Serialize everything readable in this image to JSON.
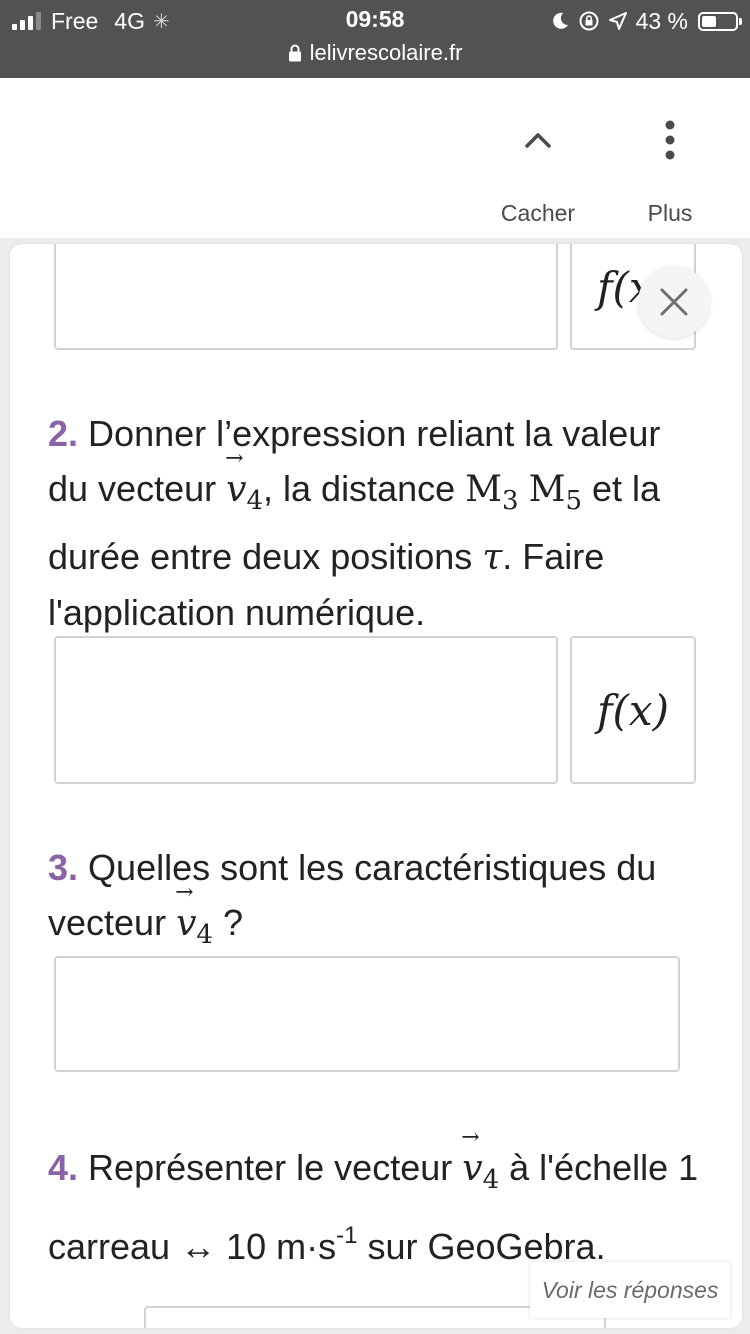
{
  "status_bar": {
    "carrier": "Free",
    "network": "4G",
    "time": "09:58",
    "battery_percent": "43 %",
    "battery_level": 0.43,
    "url": "lelivrescolaire.fr"
  },
  "toolbar": {
    "hide_label": "Cacher",
    "more_label": "Plus"
  },
  "fx_label": "f(x)",
  "questions": {
    "q2": {
      "number": "2.",
      "text_a": "Donner l’expression reliant la valeur du vecteur",
      "vector": "v",
      "vector_sub": "4",
      "text_b": ", la distance",
      "m3": "M",
      "m3_sub": "3",
      "m5": "M",
      "m5_sub": "5",
      "text_c": "et la durée entre deux positions",
      "tau": "τ",
      "text_d": ". Faire l'application numérique."
    },
    "q3": {
      "number": "3.",
      "text_a": "Quelles sont les caractéristiques du vecteur",
      "vector": "v",
      "vector_sub": "4",
      "text_b": "?"
    },
    "q4": {
      "number": "4.",
      "text_a": "Représenter le vecteur",
      "vector": "v",
      "vector_sub": "4",
      "text_b": "à l'échelle 1 carreau ↔ 10 m·s",
      "sup": "-1",
      "text_c": "sur GeoGebra."
    }
  },
  "see_answers_label": "Voir les réponses"
}
